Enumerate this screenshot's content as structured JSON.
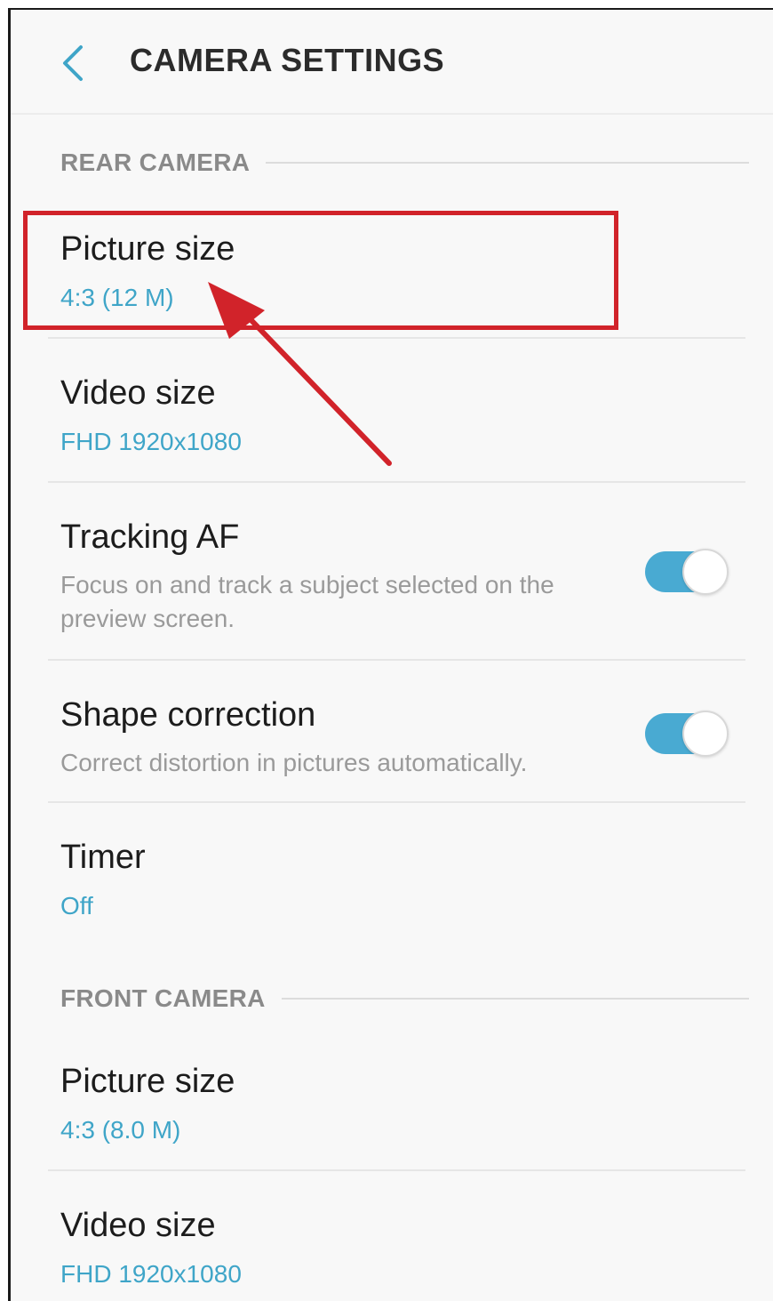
{
  "header": {
    "title": "CAMERA SETTINGS",
    "back_icon": "chevron-left-icon"
  },
  "colors": {
    "accent": "#3fa5c8",
    "annotation": "#d1232a"
  },
  "rear_camera": {
    "label": "REAR CAMERA",
    "items": [
      {
        "title": "Picture size",
        "value": "4:3 (12 M)"
      },
      {
        "title": "Video size",
        "value": "FHD 1920x1080"
      },
      {
        "title": "Tracking AF",
        "description": "Focus on and track a subject selected on the preview screen.",
        "toggle": "on"
      },
      {
        "title": "Shape correction",
        "description": "Correct distortion in pictures automatically.",
        "toggle": "on"
      },
      {
        "title": "Timer",
        "value": "Off"
      }
    ]
  },
  "front_camera": {
    "label": "FRONT CAMERA",
    "items": [
      {
        "title": "Picture size",
        "value": "4:3 (8.0 M)"
      },
      {
        "title": "Video size",
        "value": "FHD 1920x1080"
      }
    ]
  }
}
